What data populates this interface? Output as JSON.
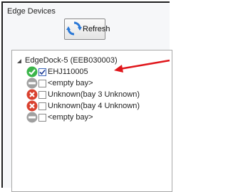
{
  "panel": {
    "title": "Edge Devices",
    "refresh_label": "Refresh"
  },
  "tree": {
    "root_label": "EdgeDock-5 (EEB030003)",
    "items": [
      {
        "label": "EHJ110005",
        "checked": true,
        "status": "ok"
      },
      {
        "label": "<empty bay>",
        "checked": false,
        "status": "empty"
      },
      {
        "label": "Unknown(bay 3 Unknown)",
        "checked": false,
        "status": "error"
      },
      {
        "label": "Unknown(bay 4 Unknown)",
        "checked": false,
        "status": "error"
      },
      {
        "label": "<empty bay>",
        "checked": false,
        "status": "empty"
      }
    ]
  },
  "colors": {
    "ok": "#3bb54a",
    "error": "#d9412f",
    "empty": "#9a9a9a",
    "annotation_arrow": "#e0161b"
  }
}
